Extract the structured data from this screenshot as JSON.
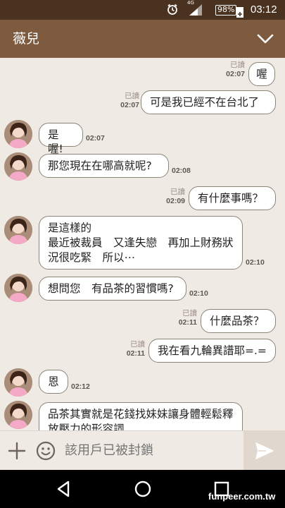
{
  "status_bar": {
    "network": "4G",
    "battery": "98%",
    "time": "03:12"
  },
  "header": {
    "title": "薇兒"
  },
  "messages": [
    {
      "side": "right",
      "text": "喔",
      "read": "已讀",
      "time": "02:07"
    },
    {
      "side": "right",
      "text": "可是我已經不在台北了",
      "read": "已讀",
      "time": "02:07"
    },
    {
      "side": "left",
      "text": "是喔!",
      "time": "02:07"
    },
    {
      "side": "left",
      "text": "那您現在在哪高就呢?",
      "time": "02:08"
    },
    {
      "side": "right",
      "text": "有什麼事嗎？",
      "read": "已讀",
      "time": "02:09"
    },
    {
      "side": "left",
      "text": "是這樣的\n最近被裁員　又逢失戀　再加上財務狀況很吃緊　所以⋯",
      "time": "02:10"
    },
    {
      "side": "left",
      "text": "想問您　有品茶的習慣嗎?",
      "time": "02:10"
    },
    {
      "side": "right",
      "text": "什麼品茶？",
      "read": "已讀",
      "time": "02:11"
    },
    {
      "side": "right",
      "text": "我在看九輪異譜耶=.=",
      "read": "已讀",
      "time": "02:11"
    },
    {
      "side": "left",
      "text": "恩",
      "time": "02:12"
    },
    {
      "side": "left",
      "text": "品茶其實就是花錢找妹妹讓身體輕鬆釋放壓力的形容詞",
      "time": ""
    }
  ],
  "input": {
    "placeholder": "該用戶已被封鎖"
  },
  "watermark": "funpeer.com.tw"
}
